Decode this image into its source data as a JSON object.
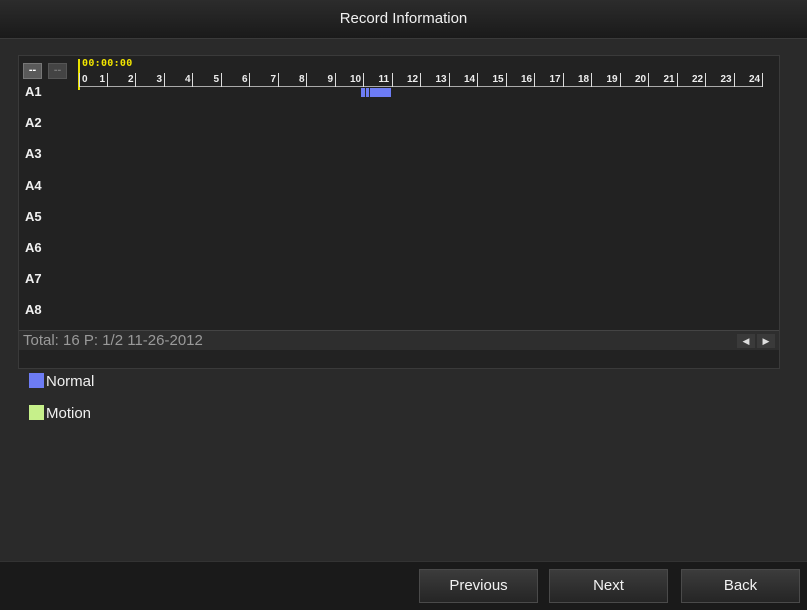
{
  "window": {
    "title": "Record Information"
  },
  "timeline": {
    "zoom_in_label": "--",
    "zoom_out_label": "--",
    "cursor_time": "00:00:00",
    "hours": [
      "0",
      "1",
      "2",
      "3",
      "4",
      "5",
      "6",
      "7",
      "8",
      "9",
      "10",
      "11",
      "12",
      "13",
      "14",
      "15",
      "16",
      "17",
      "18",
      "19",
      "20",
      "21",
      "22",
      "23",
      "24"
    ]
  },
  "channels": [
    "A1",
    "A2",
    "A3",
    "A4",
    "A5",
    "A6",
    "A7",
    "A8"
  ],
  "recordings": [
    {
      "channel": "A1",
      "type": "Normal",
      "start_hour": 9.9,
      "end_hour": 10.95
    }
  ],
  "status": {
    "text": "Total: 16  P: 1/2 11-26-2012"
  },
  "legend": [
    {
      "label": "Normal",
      "color": "#6d7cf5"
    },
    {
      "label": "Motion",
      "color": "#c6f08a"
    }
  ],
  "buttons": {
    "previous": "Previous",
    "next": "Next",
    "back": "Back"
  },
  "icons": {
    "scroll_left": "arrow-left-icon",
    "scroll_right": "arrow-right-icon"
  }
}
